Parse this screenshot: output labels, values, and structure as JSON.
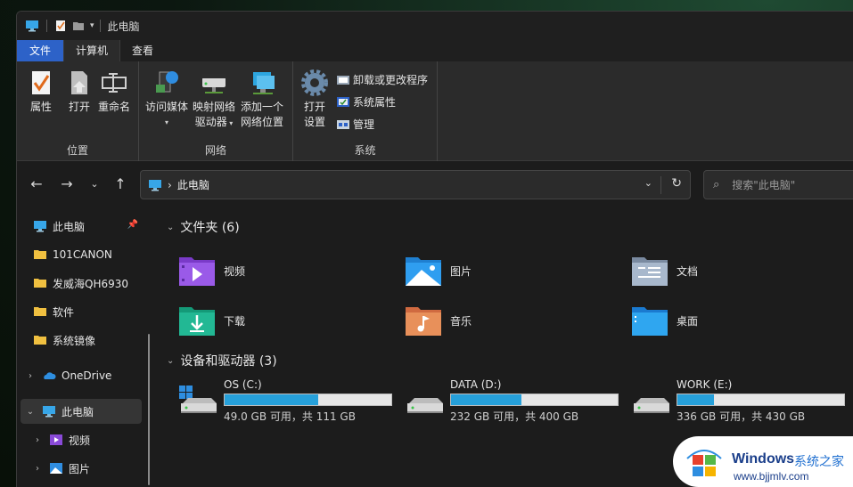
{
  "titlebar": {
    "title": "此电脑"
  },
  "tabs": [
    {
      "label": "文件"
    },
    {
      "label": "计算机"
    },
    {
      "label": "查看"
    }
  ],
  "ribbon": {
    "groups": [
      {
        "label": "位置",
        "buttons": [
          {
            "label": "属性"
          },
          {
            "label": "打开"
          },
          {
            "label": "重命名"
          }
        ]
      },
      {
        "label": "网络",
        "buttons": [
          {
            "label": "访问媒体"
          },
          {
            "label": "映射网络",
            "label2": "驱动器"
          },
          {
            "label": "添加一个",
            "label2": "网络位置"
          }
        ]
      },
      {
        "label": "系统",
        "buttons": [
          {
            "label": "打开",
            "label2": "设置"
          }
        ],
        "small_buttons": [
          {
            "label": "卸载或更改程序"
          },
          {
            "label": "系统属性"
          },
          {
            "label": "管理"
          }
        ]
      }
    ]
  },
  "address": {
    "path": "此电脑"
  },
  "search": {
    "placeholder": "搜索\"此电脑\""
  },
  "sidebar": {
    "items": [
      {
        "label": "此电脑"
      },
      {
        "label": "101CANON"
      },
      {
        "label": "发威海QH6930"
      },
      {
        "label": "软件"
      },
      {
        "label": "系统镜像"
      },
      {
        "label": "OneDrive"
      },
      {
        "label": "此电脑"
      },
      {
        "label": "视频"
      },
      {
        "label": "图片"
      }
    ]
  },
  "main": {
    "folders_heading": "文件夹 (6)",
    "folders": [
      {
        "label": "视频",
        "icon": "video-folder-icon"
      },
      {
        "label": "图片",
        "icon": "pictures-folder-icon"
      },
      {
        "label": "文档",
        "icon": "documents-folder-icon"
      },
      {
        "label": "下载",
        "icon": "downloads-folder-icon"
      },
      {
        "label": "音乐",
        "icon": "music-folder-icon"
      },
      {
        "label": "桌面",
        "icon": "desktop-folder-icon"
      }
    ],
    "drives_heading": "设备和驱动器 (3)",
    "drives": [
      {
        "name": "OS (C:)",
        "info": "49.0 GB 可用，共 111 GB",
        "used_fraction": 0.56
      },
      {
        "name": "DATA (D:)",
        "info": "232 GB 可用，共 400 GB",
        "used_fraction": 0.42
      },
      {
        "name": "WORK (E:)",
        "info": "336 GB 可用，共 430 GB",
        "used_fraction": 0.22
      }
    ]
  },
  "watermark": {
    "brand": "Windows",
    "site": "系统之家",
    "url": "www.bjjmlv.com"
  },
  "colors": {
    "accent": "#2d62c8",
    "drive_fill": "#26a0da"
  }
}
